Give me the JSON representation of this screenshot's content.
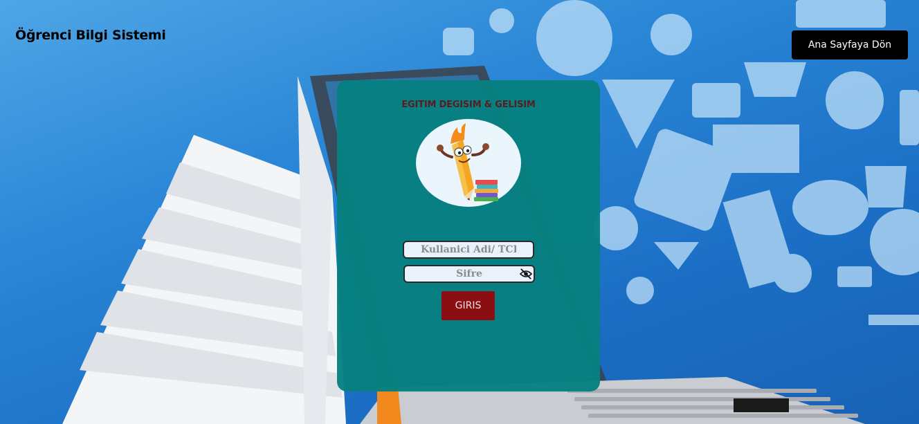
{
  "header": {
    "site_title": "Öğrenci Bilgi Sistemi",
    "home_button_label": "Ana Sayfaya Dön"
  },
  "login_card": {
    "heading": "EGITIM DEGISIM & GELISIM",
    "username_placeholder": "Kullanici Adi/ TCKN",
    "password_placeholder": "Sifre",
    "submit_label": "GIRIS"
  },
  "icons": {
    "password_toggle": "eye-slash-icon",
    "mascot": "pencil-mascot-illustration"
  },
  "colors": {
    "card_bg": "#068080",
    "submit_bg": "#8b0f12",
    "home_button_bg": "#000000",
    "heading_color": "#5a1c1c"
  }
}
